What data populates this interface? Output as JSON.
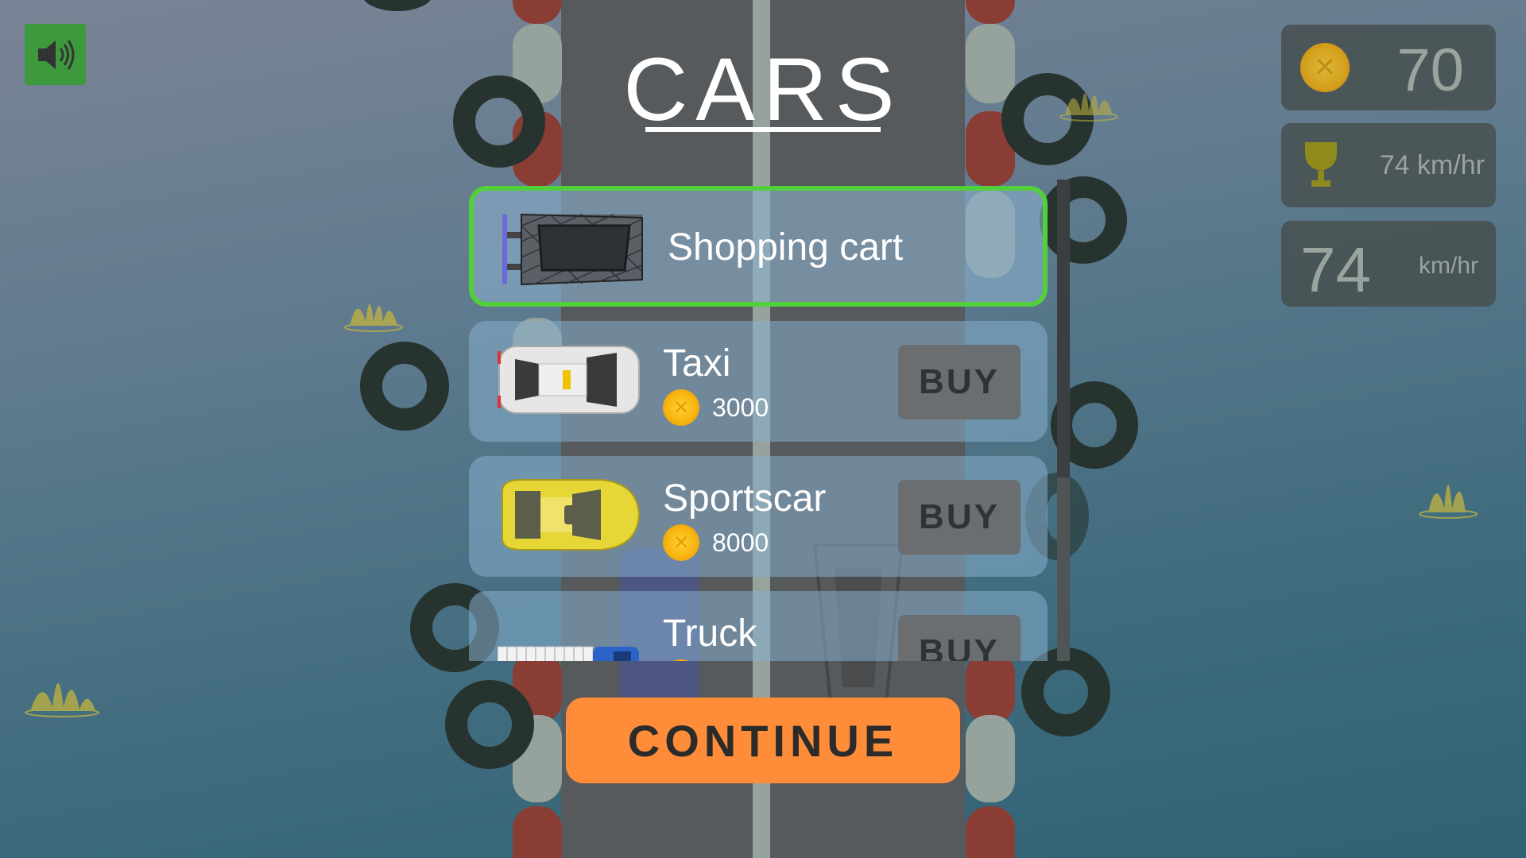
{
  "sound": {
    "icon": "speaker-icon"
  },
  "hud": {
    "coins": "70",
    "best_speed": "74 km/hr",
    "speed_value": "74",
    "speed_unit": "km/hr",
    "icons": [
      "coin-icon",
      "trophy-icon"
    ]
  },
  "title": "CARS",
  "cars": [
    {
      "name": "Shopping cart",
      "selected": true
    },
    {
      "name": "Taxi",
      "price": "3000",
      "button": "BUY"
    },
    {
      "name": "Sportscar",
      "price": "8000",
      "button": "BUY"
    },
    {
      "name": "Truck",
      "button": "BUY"
    }
  ],
  "continue_label": "CONTINUE",
  "colors": {
    "accent_orange": "#ff8c38",
    "selected_green": "#52d03c",
    "sound_green": "#3c9a3d",
    "road": "#575a5d"
  }
}
